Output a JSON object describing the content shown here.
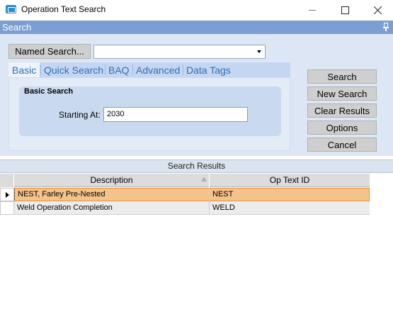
{
  "window": {
    "title": "Operation Text Search"
  },
  "search_panel": {
    "header": "Search",
    "named_search_label": "Named Search...",
    "named_search_value": "",
    "tabs": [
      "Basic",
      "Quick Search",
      "BAQ",
      "Advanced",
      "Data Tags"
    ],
    "active_tab": "Basic",
    "group_title": "Basic Search",
    "starting_at_label": "Starting At:",
    "starting_at_value": "2030"
  },
  "buttons": {
    "search": "Search",
    "new_search": "New Search",
    "clear_results": "Clear Results",
    "options": "Options",
    "cancel": "Cancel"
  },
  "results": {
    "header": "Search Results",
    "columns": [
      "Description",
      "Op Text ID"
    ],
    "rows": [
      {
        "description": "NEST, Farley Pre-Nested",
        "op_text_id": "NEST",
        "selected": true
      },
      {
        "description": "Weld Operation Completion",
        "op_text_id": "WELD",
        "selected": false
      }
    ]
  },
  "colors": {
    "header_blue": "#7b9ed3",
    "selected_row": "#f5c28a",
    "tab_text": "#2f6fb8"
  }
}
